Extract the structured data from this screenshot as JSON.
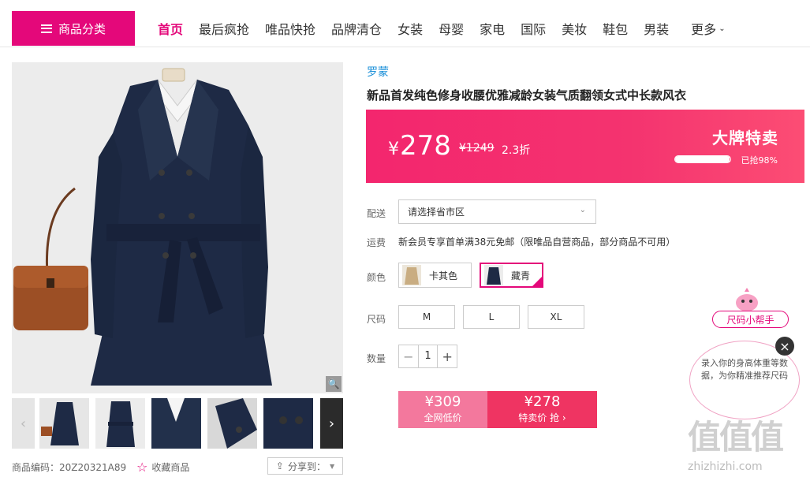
{
  "nav": {
    "category_button": "商品分类",
    "links": [
      "首页",
      "最后疯抢",
      "唯品快抢",
      "品牌清仓",
      "女装",
      "母婴",
      "家电",
      "国际",
      "美妆",
      "鞋包",
      "男装"
    ],
    "active_link": "首页",
    "more": "更多"
  },
  "product": {
    "brand": "罗蒙",
    "title": "新品首发纯色修身收腰优雅减龄女装气质翻领女式中长款风衣",
    "sku": "商品编码：20Z20321A89",
    "favorite": "收藏商品",
    "share": "分享到："
  },
  "price": {
    "current": "278",
    "currency": "¥",
    "original": "¥1249",
    "discount": "2.3折",
    "promo_label": "大牌特卖",
    "sold_text": "已抢98%",
    "sold_fraction": 0.98
  },
  "options": {
    "delivery_label": "配送",
    "delivery_placeholder": "请选择省市区",
    "shipping_label": "运费",
    "shipping_text": "新会员专享首单满38元免邮（限唯品自营商品，部分商品不可用）",
    "color_label": "颜色",
    "colors": [
      "卡其色",
      "藏青"
    ],
    "selected_color": "藏青",
    "size_label": "尺码",
    "sizes": [
      "M",
      "L",
      "XL"
    ],
    "qty_label": "数量",
    "qty": "1"
  },
  "buy": {
    "left_price": "¥309",
    "left_sub": "全网低价",
    "right_price": "¥278",
    "right_sub": "特卖价 抢 ›"
  },
  "helper": {
    "tag": "尺码小帮手",
    "bubble": "录入你的身高体重等数据，为你精准推荐尺码"
  },
  "watermark": {
    "big": "值值值",
    "small": "zhizhizhi.com"
  },
  "colors": {
    "accent": "#e4087a",
    "price_bg": "#f3266e",
    "buy_left": "#f3789d",
    "buy_right": "#ef3462",
    "brand_link": "#1a8fd8"
  }
}
